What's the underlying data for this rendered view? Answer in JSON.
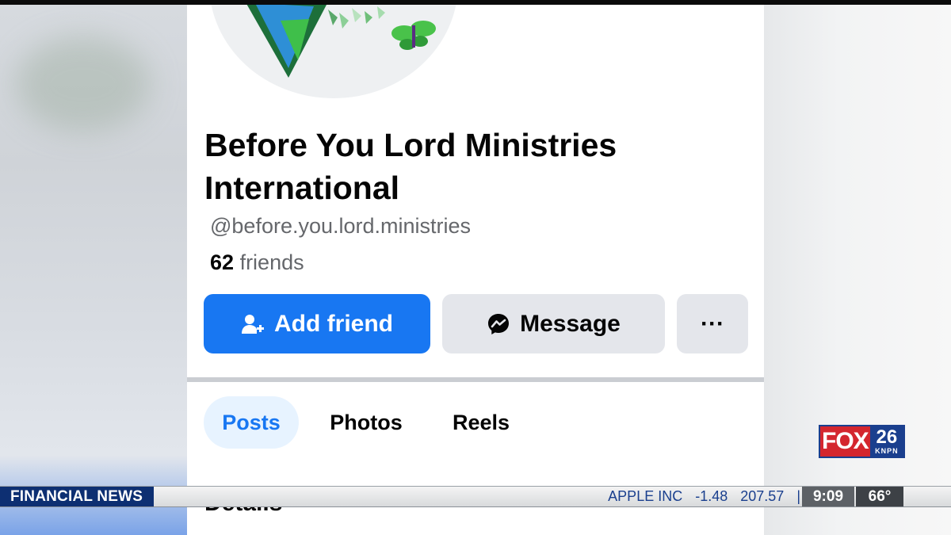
{
  "profile": {
    "name": "Before You Lord Ministries International",
    "handle": "@before.you.lord.ministries",
    "friends_count": "62",
    "friends_label": "friends"
  },
  "actions": {
    "add_friend_label": "Add friend",
    "message_label": "Message",
    "more_label": "···"
  },
  "tabs": [
    {
      "label": "Posts",
      "active": true
    },
    {
      "label": "Photos",
      "active": false
    },
    {
      "label": "Reels",
      "active": false
    }
  ],
  "section_peek": "Details",
  "ticker": {
    "label": "FINANCIAL NEWS",
    "stock_name": "APPLE INC",
    "stock_change": "-1.48",
    "stock_price": "207.57",
    "separator": "|",
    "time": "9:09",
    "temperature": "66°"
  },
  "logo": {
    "network": "FOX",
    "channel": "26",
    "callsign": "KNPN"
  },
  "icons": [
    "add-friend-icon",
    "messenger-icon",
    "more-icon"
  ],
  "colors": {
    "primary_blue": "#1877f2",
    "secondary_button": "#e4e6eb",
    "ticker_navy": "#0d2f72",
    "logo_red": "#d4262e"
  }
}
